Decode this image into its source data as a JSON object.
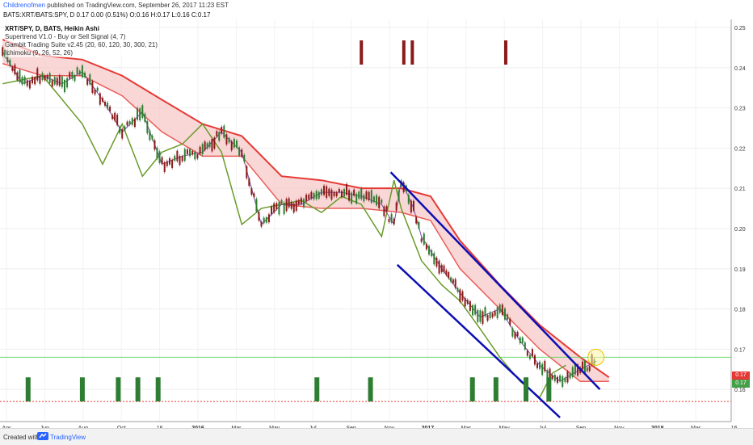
{
  "header": {
    "author": "Childrenofmen",
    "published": "published on TradingView.com, September 26, 2017 11:23 EST",
    "symbol_line": "BATS:XRT/BATS:SPY, D  0.17  0.00 (0.51%)  O:0.16  H:0.17  L:0.16  C:0.17"
  },
  "legend": {
    "title": "XRT/SPY, D, BATS, Heikin Ashi",
    "items": [
      "Supertrend V1.0 - Buy or Sell Signal (4, 7)",
      "Gambit Trading Suite v2.45 (20, 60, 120, 30, 300, 21)",
      "Ichimoku (9, 26, 52, 26)"
    ]
  },
  "price_tags": {
    "red": "0.17",
    "green": "0.17"
  },
  "footer": {
    "created": "Created with",
    "brand": "TradingView"
  },
  "colors": {
    "up": "#2e7d32",
    "down": "#8b1a1a",
    "blue_channel": "#0d0fb3",
    "ichimoku_red": "#e53935",
    "ichimoku_green": "#43a047",
    "cloud_red": "#f7c6c6",
    "cloud_green": "#d7ecd7",
    "ma_purple": "#7b4fa8",
    "ma_blue": "#1f4fd8",
    "price_line_red": "#e53935",
    "price_line_green": "#5cd65c"
  },
  "icons": {
    "footer_logo": "tradingview-logo-icon"
  },
  "chart_data": {
    "type": "line",
    "title": "XRT/SPY, D, BATS, Heikin Ashi",
    "xlabel": "",
    "ylabel": "",
    "ylim": [
      0.152,
      0.252
    ],
    "y_ticks": [
      0.16,
      0.17,
      0.18,
      0.19,
      0.2,
      0.21,
      0.22,
      0.23,
      0.24,
      0.25
    ],
    "x_tick_labels": [
      "Apr",
      "Jun",
      "Aug",
      "Oct",
      "16",
      "2016",
      "Mar",
      "May",
      "Jul",
      "Sep",
      "Nov",
      "2017",
      "Mar",
      "May",
      "Jul",
      "Sep",
      "Nov",
      "2018",
      "Mar",
      "16"
    ],
    "grid": true,
    "series": [
      {
        "role": "price",
        "x": [
          "2015-04-01",
          "2015-05-01",
          "2015-06-01",
          "2015-07-01",
          "2015-08-01",
          "2015-09-01",
          "2015-10-01",
          "2015-11-01",
          "2015-12-01",
          "2016-01-01",
          "2016-02-01",
          "2016-03-01",
          "2016-04-01",
          "2016-05-01",
          "2016-06-01",
          "2016-07-01",
          "2016-08-01",
          "2016-09-01",
          "2016-10-01",
          "2016-11-01",
          "2016-11-20",
          "2016-12-01",
          "2016-12-20",
          "2017-01-01",
          "2017-02-01",
          "2017-03-01",
          "2017-04-01",
          "2017-05-01",
          "2017-06-01",
          "2017-07-01",
          "2017-08-01",
          "2017-09-01",
          "2017-09-26"
        ],
        "values": [
          0.244,
          0.236,
          0.238,
          0.236,
          0.239,
          0.232,
          0.224,
          0.229,
          0.216,
          0.218,
          0.219,
          0.224,
          0.219,
          0.201,
          0.206,
          0.206,
          0.209,
          0.209,
          0.208,
          0.206,
          0.201,
          0.212,
          0.205,
          0.198,
          0.19,
          0.184,
          0.178,
          0.18,
          0.172,
          0.166,
          0.162,
          0.165,
          0.167
        ]
      },
      {
        "role": "ichimoku-cloud-upper",
        "x": [
          "2015-04-01",
          "2015-06-01",
          "2015-08-01",
          "2015-10-01",
          "2015-12-01",
          "2016-02-01",
          "2016-04-01",
          "2016-06-01",
          "2016-08-01",
          "2016-10-01",
          "2016-12-01",
          "2017-01-15",
          "2017-03-01",
          "2017-05-01",
          "2017-07-01",
          "2017-09-01",
          "2017-10-15"
        ],
        "values": [
          0.247,
          0.243,
          0.242,
          0.238,
          0.232,
          0.226,
          0.223,
          0.213,
          0.212,
          0.21,
          0.21,
          0.208,
          0.197,
          0.186,
          0.176,
          0.168,
          0.163
        ]
      },
      {
        "role": "ichimoku-cloud-lower",
        "x": [
          "2015-04-01",
          "2015-06-01",
          "2015-08-01",
          "2015-10-01",
          "2015-12-01",
          "2016-02-01",
          "2016-04-01",
          "2016-06-01",
          "2016-08-01",
          "2016-10-01",
          "2016-12-01",
          "2017-01-15",
          "2017-03-01",
          "2017-05-01",
          "2017-07-01",
          "2017-09-01",
          "2017-10-15"
        ],
        "values": [
          0.241,
          0.238,
          0.238,
          0.233,
          0.224,
          0.218,
          0.218,
          0.206,
          0.205,
          0.205,
          0.204,
          0.202,
          0.19,
          0.18,
          0.17,
          0.162,
          0.162
        ]
      },
      {
        "role": "lagging-span",
        "x": [
          "2015-04-01",
          "2015-06-01",
          "2015-08-01",
          "2015-09-01",
          "2015-10-01",
          "2015-11-01",
          "2015-12-01",
          "2016-01-01",
          "2016-02-01",
          "2016-03-01",
          "2016-04-01",
          "2016-05-01",
          "2016-06-01",
          "2016-07-01",
          "2016-08-01",
          "2016-09-01",
          "2016-10-01",
          "2016-11-01",
          "2016-11-20",
          "2016-12-01",
          "2017-01-01",
          "2017-02-01",
          "2017-03-01",
          "2017-04-01",
          "2017-05-01",
          "2017-06-01",
          "2017-07-01",
          "2017-07-20",
          "2017-08-10"
        ],
        "values": [
          0.236,
          0.238,
          0.226,
          0.216,
          0.226,
          0.213,
          0.219,
          0.221,
          0.226,
          0.219,
          0.201,
          0.205,
          0.206,
          0.207,
          0.204,
          0.208,
          0.206,
          0.198,
          0.212,
          0.205,
          0.192,
          0.186,
          0.182,
          0.175,
          0.168,
          0.162,
          0.158,
          0.164,
          0.166
        ]
      },
      {
        "role": "channel-upper",
        "x": [
          "2016-11-15",
          "2017-10-01"
        ],
        "values": [
          0.214,
          0.16
        ]
      },
      {
        "role": "channel-lower",
        "x": [
          "2016-11-25",
          "2017-08-01"
        ],
        "values": [
          0.191,
          0.153
        ]
      }
    ],
    "volume_markers_dates": [
      "2015-05-10",
      "2015-08-01",
      "2015-09-25",
      "2015-10-25",
      "2015-11-25",
      "2016-07-25",
      "2016-10-15",
      "2017-03-20",
      "2017-04-25",
      "2017-06-10",
      "2017-07-15"
    ],
    "signal_markers_dates": [
      "2016-10-01",
      "2016-12-05",
      "2016-12-18",
      "2017-05-10"
    ],
    "highlight_circle": {
      "date": "2017-09-25",
      "value": 0.168
    },
    "horizontal_lines": [
      0.168,
      0.157
    ]
  }
}
